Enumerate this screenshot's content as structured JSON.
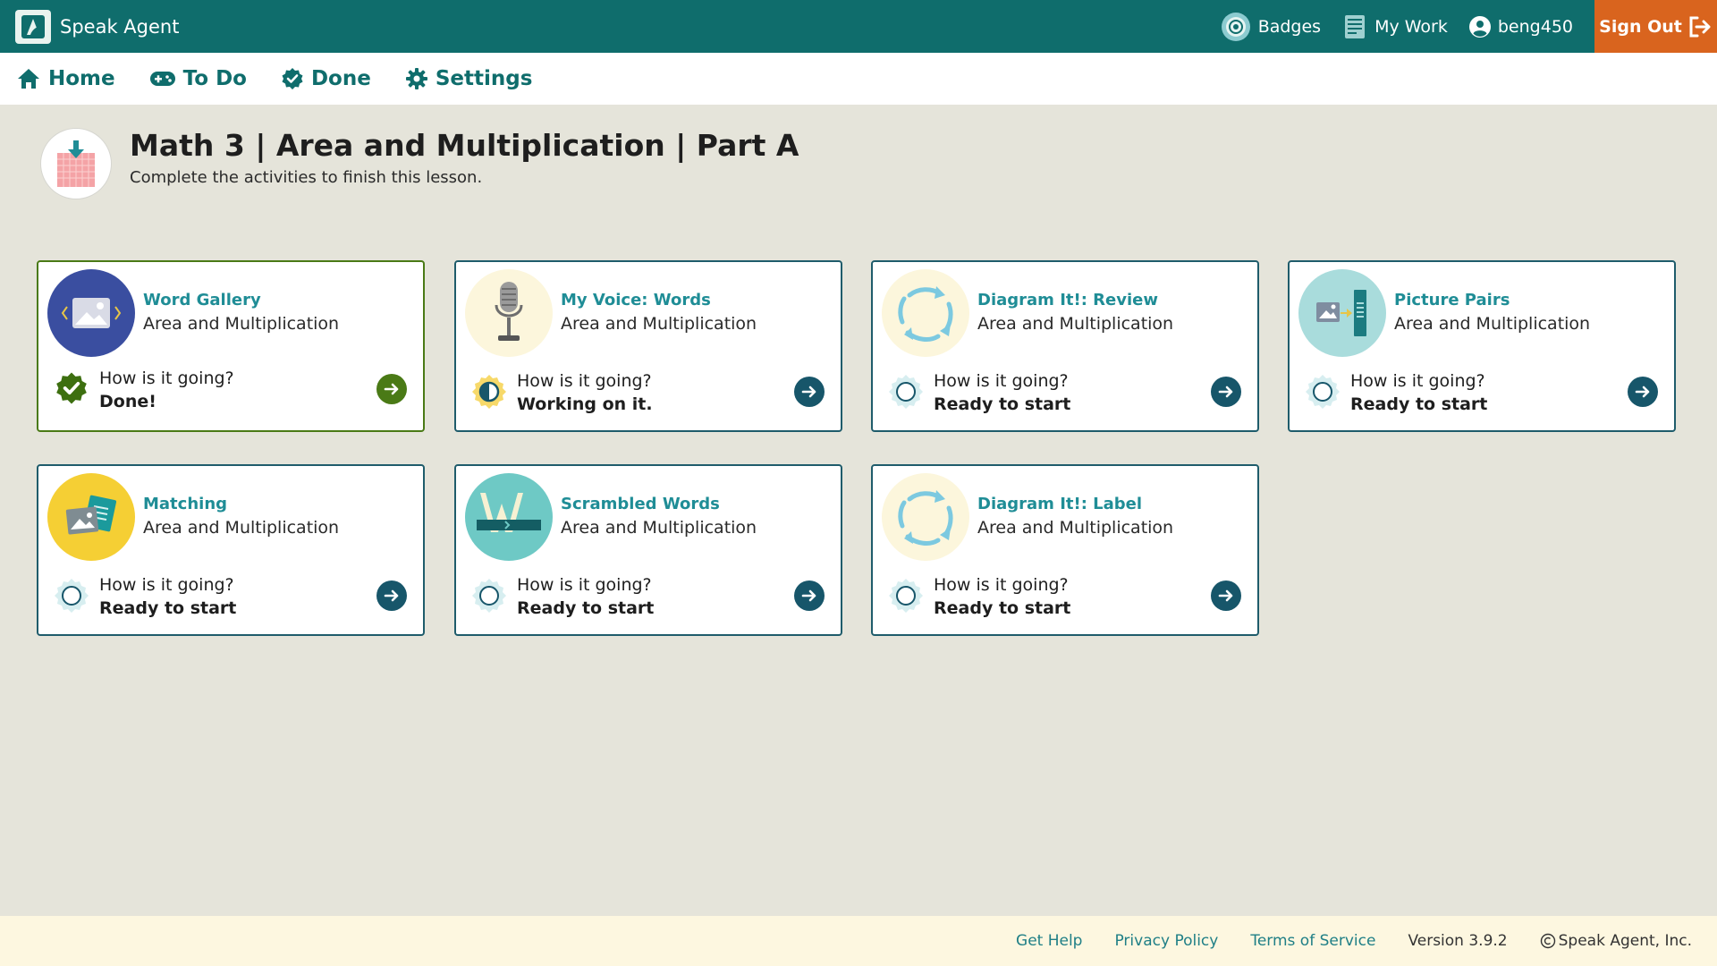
{
  "app": {
    "name": "Speak Agent"
  },
  "topbar": {
    "badges_label": "Badges",
    "mywork_label": "My Work",
    "username": "beng450",
    "signout_label": "Sign Out"
  },
  "nav": {
    "home": "Home",
    "todo": "To Do",
    "done": "Done",
    "settings": "Settings"
  },
  "lesson": {
    "title": "Math 3 | Area and Multiplication | Part A",
    "subtitle": "Complete the activities to finish this lesson."
  },
  "activities": [
    {
      "name": "Word Gallery",
      "topic": "Area and Multiplication",
      "question": "How is it going?",
      "status": "Done!",
      "icon": "image-gallery-icon"
    },
    {
      "name": "My Voice: Words",
      "topic": "Area and Multiplication",
      "question": "How is it going?",
      "status": "Working on it.",
      "icon": "microphone-icon"
    },
    {
      "name": "Diagram It!: Review",
      "topic": "Area and Multiplication",
      "question": "How is it going?",
      "status": "Ready to start",
      "icon": "cycle-arrows-icon"
    },
    {
      "name": "Picture Pairs",
      "topic": "Area and Multiplication",
      "question": "How is it going?",
      "status": "Ready to start",
      "icon": "picture-pairs-icon"
    },
    {
      "name": "Matching",
      "topic": "Area and Multiplication",
      "question": "How is it going?",
      "status": "Ready to start",
      "icon": "matching-cards-icon"
    },
    {
      "name": "Scrambled Words",
      "topic": "Area and Multiplication",
      "question": "How is it going?",
      "status": "Ready to start",
      "icon": "scrambled-letter-icon"
    },
    {
      "name": "Diagram It!: Label",
      "topic": "Area and Multiplication",
      "question": "How is it going?",
      "status": "Ready to start",
      "icon": "cycle-arrows-icon"
    }
  ],
  "footer": {
    "get_help": "Get Help",
    "privacy": "Privacy Policy",
    "terms": "Terms of Service",
    "version": "Version 3.9.2",
    "copyright": "Speak Agent, Inc."
  },
  "colors": {
    "topbar": "#0f6d6c",
    "signout": "#d9641e",
    "accent_text": "#1f8d96",
    "done_green": "#4a7a16",
    "card_border": "#1f5c6b",
    "background": "#e5e4da",
    "footer_bg": "#fdf7e0"
  }
}
